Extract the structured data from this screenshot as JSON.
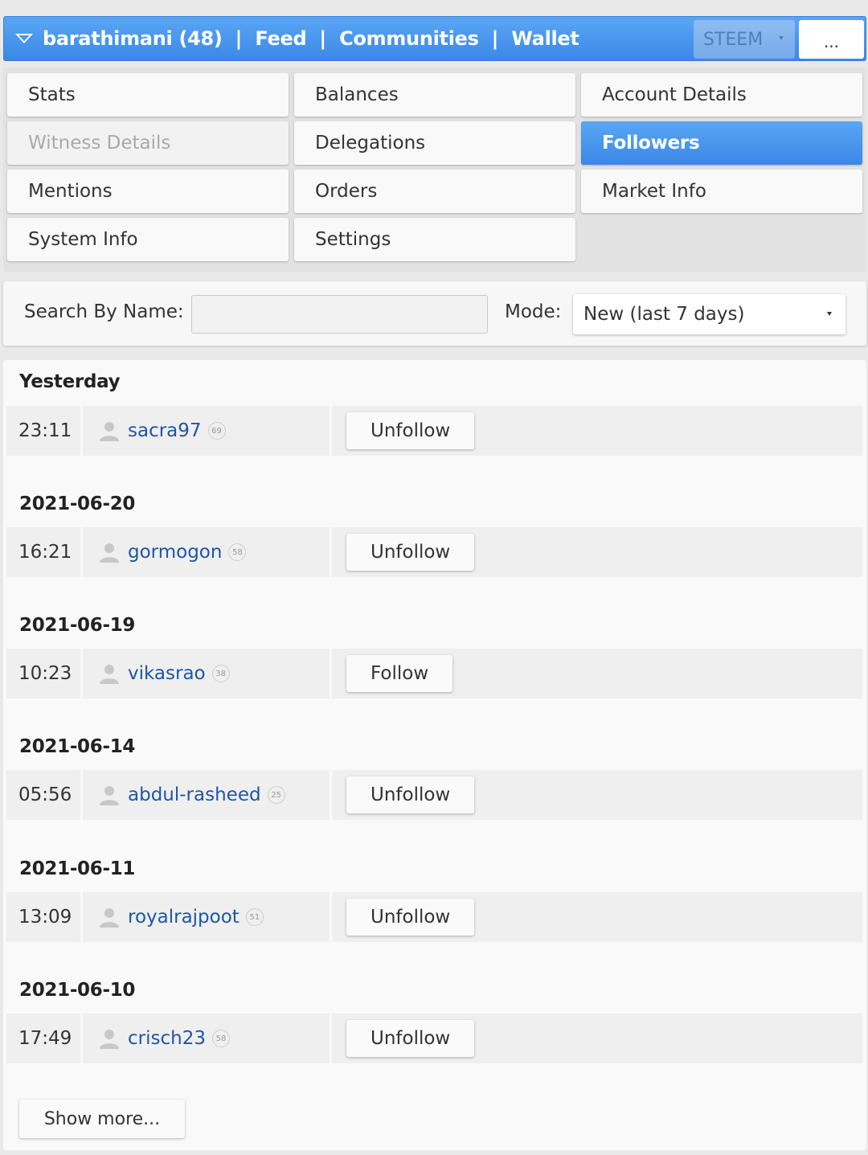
{
  "topbar": {
    "account": "barathimani (48)",
    "nav": [
      "Feed",
      "Communities",
      "Wallet"
    ],
    "currency": "STEEM",
    "more": "..."
  },
  "menu": {
    "items": [
      {
        "label": "Stats",
        "state": "normal"
      },
      {
        "label": "Balances",
        "state": "normal"
      },
      {
        "label": "Account Details",
        "state": "normal"
      },
      {
        "label": "Witness Details",
        "state": "disabled"
      },
      {
        "label": "Delegations",
        "state": "normal"
      },
      {
        "label": "Followers",
        "state": "active"
      },
      {
        "label": "Mentions",
        "state": "normal"
      },
      {
        "label": "Orders",
        "state": "normal"
      },
      {
        "label": "Market Info",
        "state": "normal"
      },
      {
        "label": "System Info",
        "state": "normal"
      },
      {
        "label": "Settings",
        "state": "normal"
      }
    ]
  },
  "search": {
    "label": "Search By Name:",
    "value": "",
    "mode_label": "Mode:",
    "mode_value": "New (last 7 days)"
  },
  "groups": [
    {
      "title": "Yesterday",
      "time": "23:11",
      "user": "sacra97",
      "rep": "69",
      "action": "Unfollow"
    },
    {
      "title": "2021-06-20",
      "time": "16:21",
      "user": "gormogon",
      "rep": "58",
      "action": "Unfollow"
    },
    {
      "title": "2021-06-19",
      "time": "10:23",
      "user": "vikasrao",
      "rep": "38",
      "action": "Follow"
    },
    {
      "title": "2021-06-14",
      "time": "05:56",
      "user": "abdul-rasheed",
      "rep": "25",
      "action": "Unfollow"
    },
    {
      "title": "2021-06-11",
      "time": "13:09",
      "user": "royalrajpoot",
      "rep": "51",
      "action": "Unfollow"
    },
    {
      "title": "2021-06-10",
      "time": "17:49",
      "user": "crisch23",
      "rep": "58",
      "action": "Unfollow"
    }
  ],
  "show_more": "Show more...",
  "colors": {
    "accent": "#3c87e6",
    "link": "#1f55a8"
  }
}
